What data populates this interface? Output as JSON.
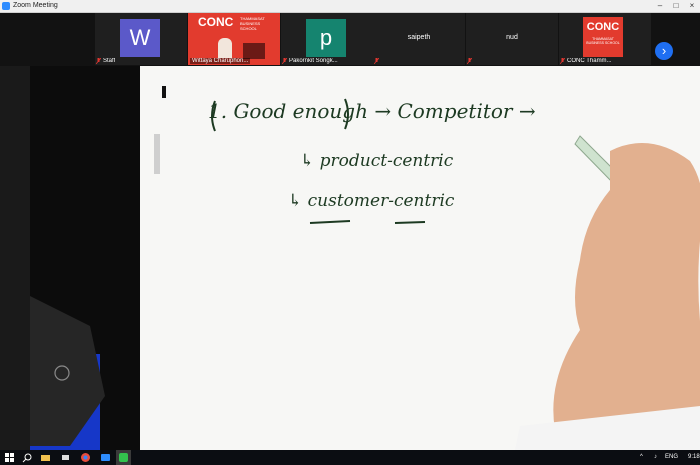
{
  "window": {
    "title": "Zoom Meeting"
  },
  "participants": [
    {
      "name": "Staff",
      "type": "avatar",
      "initial": "W",
      "color": "#5b59c9",
      "muted": true
    },
    {
      "name": "Wittaya Charuphon...",
      "type": "video",
      "logo_text": "CONC",
      "logo_sub": "THAMMASAT BUSINESS SCHOOL",
      "muted": false
    },
    {
      "name": "Pakornkit Songk...",
      "type": "avatar",
      "initial": "p",
      "color": "#15846f",
      "muted": true
    },
    {
      "name": "saipeth",
      "type": "name-only",
      "muted": true
    },
    {
      "name": "nud",
      "type": "name-only",
      "muted": true
    },
    {
      "name": "CONC Thamm...",
      "type": "logo",
      "logo_text": "CONC",
      "logo_sub": "THAMMASAT BUSINESS SCHOOL",
      "muted": true
    }
  ],
  "whiteboard": {
    "lines": [
      "1. Good enough → Competitor →",
      "↳ product-centric",
      "↳ customer-centric"
    ]
  },
  "taskbar": {
    "language": "ENG",
    "time": "9:18"
  },
  "colors": {
    "zoom_blue": "#1f6ff2",
    "conc_red": "#e23b2e"
  }
}
